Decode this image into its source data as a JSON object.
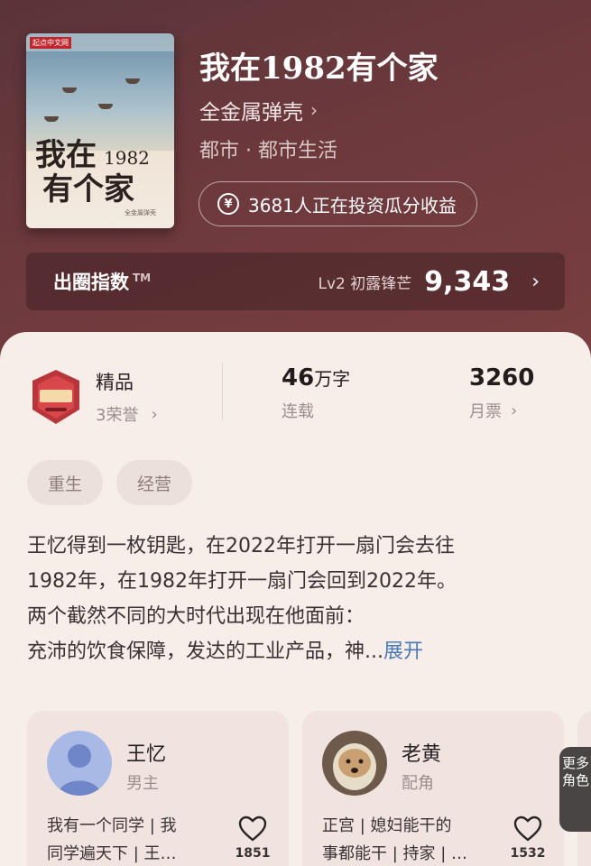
{
  "book": {
    "title": "我在1982有个家",
    "author": "全金属弹壳",
    "genre": "都市 · 都市生活",
    "invest_text": "3681人正在投资瓜分收益",
    "cover": {
      "publisher": "起点中文网",
      "title_part1": "我在",
      "title_year": "1982",
      "title_part2": "有个家",
      "author": "全金属弹壳"
    }
  },
  "index_bar": {
    "label": "出圈指数",
    "tm": "TM",
    "level": "Lv2 初露锋芒",
    "score": "9,343"
  },
  "stats": {
    "quality": {
      "title": "精品",
      "honors": "3荣誉"
    },
    "words": {
      "value": "46",
      "unit": "万字",
      "label": "连载"
    },
    "tickets": {
      "value": "3260",
      "label": "月票"
    }
  },
  "tags": [
    "重生",
    "经营"
  ],
  "description": {
    "line1": "王忆得到一枚钥匙，在2022年打开一扇门会去往",
    "line2": "1982年，在1982年打开一扇门会回到2022年。",
    "line3": "两个截然不同的大时代出现在他面前：",
    "line4": "充沛的饮食保障，发达的工业产品，神...",
    "expand": "展开"
  },
  "characters": [
    {
      "name": "王忆",
      "role": "男主",
      "desc_line1": "我有一个同学 | 我",
      "desc_line2": "同学遍天下 | 王…",
      "likes": "1851"
    },
    {
      "name": "老黄",
      "role": "配角",
      "desc_line1": "正宫 | 媳妇能干的",
      "desc_line2": "事都能干 | 持家 | …",
      "likes": "1532"
    }
  ],
  "more_characters": "更多角色",
  "colors": {
    "accent_blue": "#4a79b5",
    "hero_bg": "#6d393d",
    "sheet_bg": "#f7ede9"
  }
}
